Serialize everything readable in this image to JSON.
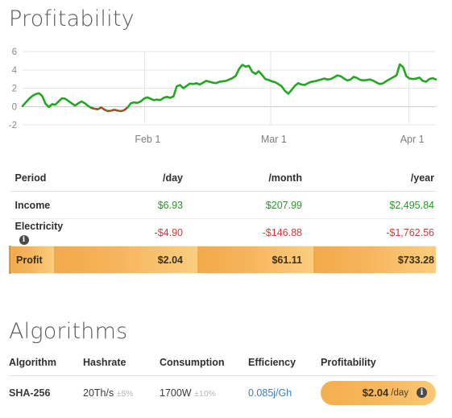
{
  "profitability": {
    "title": "Profitability",
    "table": {
      "headers": [
        "Period",
        "/day",
        "/month",
        "/year"
      ],
      "rows": [
        {
          "label": "Income",
          "day": "$6.93",
          "month": "$207.99",
          "year": "$2,495.84",
          "info": false
        },
        {
          "label": "Electricity",
          "day": "-$4.90",
          "month": "-$146.88",
          "year": "-$1,762.56",
          "info": true
        },
        {
          "label": "Profit",
          "day": "$2.04",
          "month": "$61.11",
          "year": "$733.28",
          "info": false
        }
      ]
    }
  },
  "algorithms": {
    "title": "Algorithms",
    "headers": [
      "Algorithm",
      "Hashrate",
      "Consumption",
      "Efficiency",
      "Profitability"
    ],
    "rows": [
      {
        "name": "SHA-256",
        "hashrate": "20Th/s",
        "hashrate_tolerance": "±5%",
        "consumption": "1700W",
        "consumption_tolerance": "±10%",
        "efficiency": "0.085j/Gh",
        "profit_amount": "$2.04",
        "profit_period": "/day",
        "info_icon": "info-icon"
      }
    ]
  },
  "colors": {
    "line_positive": "#22a722",
    "line_negative": "#c0392b",
    "income": "#259b24",
    "expense": "#d23a3a",
    "accent_orange": "#f4ac4e",
    "link_blue": "#3a7fc1"
  },
  "chart_data": {
    "type": "line",
    "title": "Profitability",
    "xlabel": "",
    "ylabel": "",
    "ylim": [
      -2,
      6
    ],
    "yticks": [
      -2,
      0,
      2,
      4,
      6
    ],
    "xticks": [
      "Feb 1",
      "Mar 1",
      "Apr 1"
    ],
    "xtick_positions": [
      0.295,
      0.6,
      0.935
    ],
    "grid": true,
    "legend": false,
    "series": [
      {
        "name": "Profitability",
        "color": "#22a722",
        "negative_color": "#c0392b",
        "values": [
          0.05,
          0.45,
          0.85,
          1.15,
          1.35,
          1.45,
          1.15,
          0.3,
          -0.05,
          0.25,
          0.2,
          0.55,
          0.9,
          0.85,
          0.6,
          0.35,
          0.1,
          0.35,
          0.55,
          0.35,
          0.05,
          -0.15,
          -0.25,
          -0.3,
          -0.1,
          -0.35,
          -0.5,
          -0.45,
          -0.35,
          -0.45,
          -0.5,
          -0.4,
          -0.1,
          0.35,
          0.45,
          0.4,
          0.55,
          0.85,
          1.0,
          0.85,
          0.7,
          0.75,
          0.7,
          0.95,
          1.05,
          0.95,
          1.1,
          2.2,
          2.35,
          2.0,
          2.25,
          2.5,
          2.45,
          2.55,
          2.4,
          2.6,
          2.8,
          2.7,
          2.6,
          2.55,
          2.7,
          2.75,
          2.8,
          2.95,
          3.1,
          3.35,
          4.1,
          4.55,
          4.35,
          4.45,
          3.8,
          3.55,
          3.85,
          3.45,
          3.0,
          2.9,
          2.75,
          2.65,
          2.45,
          2.2,
          1.7,
          1.4,
          1.8,
          2.25,
          2.55,
          2.4,
          2.35,
          2.55,
          2.7,
          2.75,
          2.85,
          2.95,
          3.05,
          2.95,
          3.0,
          3.2,
          3.4,
          3.3,
          3.05,
          2.85,
          2.95,
          3.25,
          3.1,
          2.9,
          2.85,
          2.9,
          2.95,
          2.8,
          2.6,
          2.45,
          2.55,
          2.8,
          3.0,
          3.2,
          3.4,
          4.6,
          4.3,
          3.3,
          3.05,
          3.0,
          3.05,
          3.15,
          2.8,
          2.7,
          3.0,
          3.1,
          2.95
        ]
      }
    ]
  }
}
